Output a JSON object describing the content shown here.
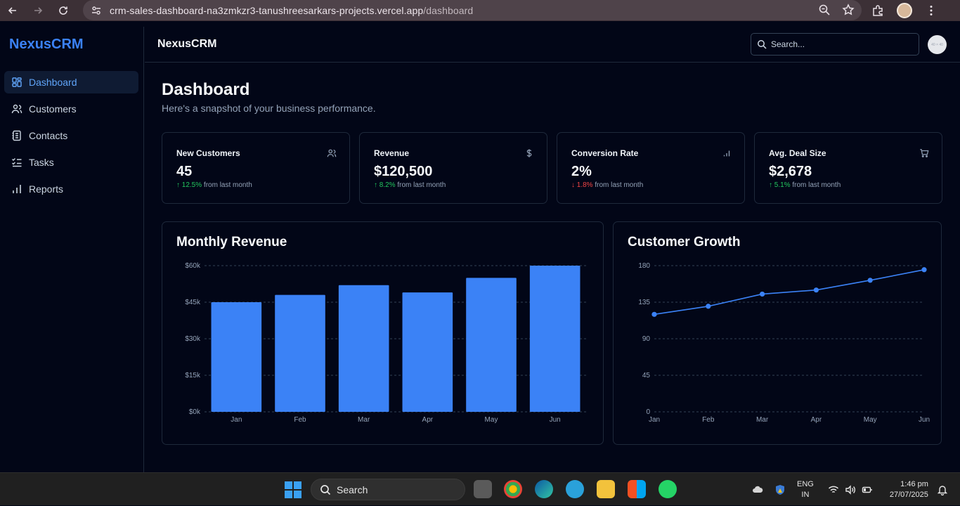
{
  "browser": {
    "url_host": "crm-sales-dashboard-na3zmkzr3-tanushreesarkars-projects.vercel.app",
    "url_path": "/dashboard"
  },
  "sidebar": {
    "brand": "NexusCRM",
    "items": [
      {
        "label": "Dashboard",
        "icon": "dashboard-icon",
        "active": true
      },
      {
        "label": "Customers",
        "icon": "users-icon"
      },
      {
        "label": "Contacts",
        "icon": "contacts-icon"
      },
      {
        "label": "Tasks",
        "icon": "tasks-icon"
      },
      {
        "label": "Reports",
        "icon": "bar-chart-icon"
      }
    ]
  },
  "topbar": {
    "title": "NexusCRM",
    "search_placeholder": "Search...",
    "avatar_text": "40 × 40"
  },
  "page": {
    "title": "Dashboard",
    "subtitle": "Here's a snapshot of your business performance."
  },
  "stats": [
    {
      "label": "New Customers",
      "value": "45",
      "change": "12.5%",
      "direction": "up",
      "suffix": "from last month",
      "icon": "users-icon"
    },
    {
      "label": "Revenue",
      "value": "$120,500",
      "change": "8.2%",
      "direction": "up",
      "suffix": "from last month",
      "icon": "dollar-icon"
    },
    {
      "label": "Conversion Rate",
      "value": "2%",
      "change": "1.8%",
      "direction": "down",
      "suffix": "from last month",
      "icon": "signal-icon"
    },
    {
      "label": "Avg. Deal Size",
      "value": "$2,678",
      "change": "5.1%",
      "direction": "up",
      "suffix": "from last month",
      "icon": "cart-icon"
    }
  ],
  "colors": {
    "accent": "#3b82f6",
    "positive": "#22c55e",
    "negative": "#ef4444",
    "background": "#020617",
    "border": "#1e293b"
  },
  "chart_data": [
    {
      "type": "bar",
      "title": "Monthly Revenue",
      "categories": [
        "Jan",
        "Feb",
        "Mar",
        "Apr",
        "May",
        "Jun"
      ],
      "values": [
        45000,
        48000,
        52000,
        49000,
        55000,
        60000
      ],
      "yticks": [
        0,
        15000,
        30000,
        45000,
        60000
      ],
      "ytick_labels": [
        "$0k",
        "$15k",
        "$30k",
        "$45k",
        "$60k"
      ],
      "ylim": [
        0,
        60000
      ],
      "grid": true,
      "color": "#3b82f6"
    },
    {
      "type": "line",
      "title": "Customer Growth",
      "categories": [
        "Jan",
        "Feb",
        "Mar",
        "Apr",
        "May",
        "Jun"
      ],
      "values": [
        120,
        130,
        145,
        150,
        162,
        175
      ],
      "yticks": [
        0,
        45,
        90,
        135,
        180
      ],
      "ytick_labels": [
        "0",
        "45",
        "90",
        "135",
        "180"
      ],
      "ylim": [
        0,
        180
      ],
      "grid": true,
      "color": "#3b82f6"
    }
  ],
  "taskbar": {
    "search_label": "Search",
    "language_line1": "ENG",
    "language_line2": "IN",
    "time": "1:46 pm",
    "date": "27/07/2025"
  }
}
